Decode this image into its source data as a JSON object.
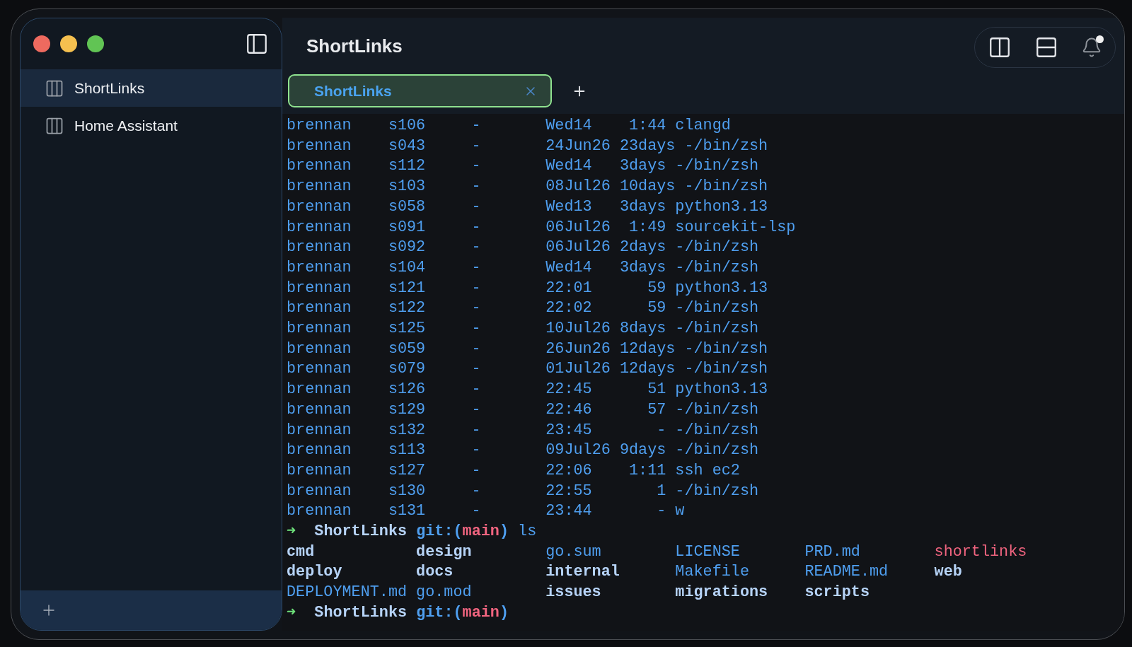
{
  "window": {
    "title": "ShortLinks"
  },
  "sidebar": {
    "items": [
      {
        "label": "ShortLinks",
        "selected": true
      },
      {
        "label": "Home Assistant",
        "selected": false
      }
    ]
  },
  "tabs": [
    {
      "label": "ShortLinks",
      "selected": true
    }
  ],
  "terminal": {
    "process_lines": [
      "brennan    s106     -       Wed14    1:44 clangd",
      "brennan    s043     -       24Jun26 23days -/bin/zsh",
      "brennan    s112     -       Wed14   3days -/bin/zsh",
      "brennan    s103     -       08Jul26 10days -/bin/zsh",
      "brennan    s058     -       Wed13   3days python3.13",
      "brennan    s091     -       06Jul26  1:49 sourcekit-lsp",
      "brennan    s092     -       06Jul26 2days -/bin/zsh",
      "brennan    s104     -       Wed14   3days -/bin/zsh",
      "brennan    s121     -       22:01      59 python3.13",
      "brennan    s122     -       22:02      59 -/bin/zsh",
      "brennan    s125     -       10Jul26 8days -/bin/zsh",
      "brennan    s059     -       26Jun26 12days -/bin/zsh",
      "brennan    s079     -       01Jul26 12days -/bin/zsh",
      "brennan    s126     -       22:45      51 python3.13",
      "brennan    s129     -       22:46      57 -/bin/zsh",
      "brennan    s132     -       23:45       - -/bin/zsh",
      "brennan    s113     -       09Jul26 9days -/bin/zsh",
      "brennan    s127     -       22:06    1:11 ssh ec2",
      "brennan    s130     -       22:55       1 -/bin/zsh",
      "brennan    s131     -       23:44       - w"
    ],
    "prompt": {
      "arrow": "➜",
      "dir": "ShortLinks",
      "git_open": "git:(",
      "branch": "main",
      "git_close": ")",
      "command": "ls"
    },
    "ls_entries": [
      {
        "name": "cmd",
        "kind": "dir"
      },
      {
        "name": "design",
        "kind": "dir"
      },
      {
        "name": "go.sum",
        "kind": "file"
      },
      {
        "name": "LICENSE",
        "kind": "file"
      },
      {
        "name": "PRD.md",
        "kind": "file"
      },
      {
        "name": "shortlinks",
        "kind": "exec"
      },
      {
        "name": "deploy",
        "kind": "dir"
      },
      {
        "name": "docs",
        "kind": "dir"
      },
      {
        "name": "internal",
        "kind": "dir"
      },
      {
        "name": "Makefile",
        "kind": "file"
      },
      {
        "name": "README.md",
        "kind": "file"
      },
      {
        "name": "web",
        "kind": "dir"
      },
      {
        "name": "DEPLOYMENT.md",
        "kind": "file"
      },
      {
        "name": "go.mod",
        "kind": "file"
      },
      {
        "name": "issues",
        "kind": "dir"
      },
      {
        "name": "migrations",
        "kind": "dir"
      },
      {
        "name": "scripts",
        "kind": "dir"
      }
    ],
    "final_prompt": {
      "arrow": "➜",
      "dir": "ShortLinks",
      "git_open": "git:(",
      "branch": "main",
      "git_close": ")"
    }
  }
}
